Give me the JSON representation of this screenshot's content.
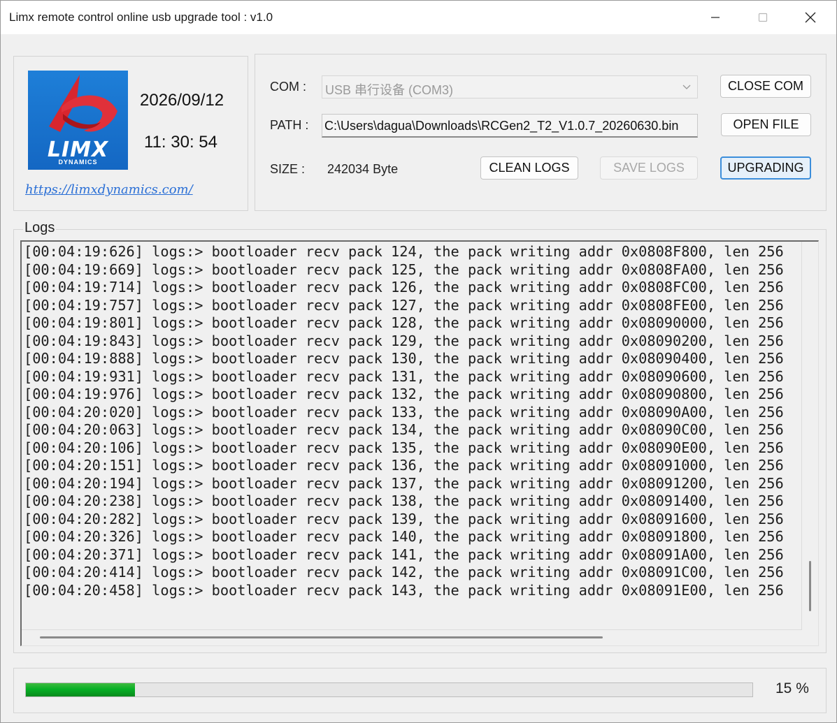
{
  "window": {
    "title": "Limx remote control online usb upgrade tool : v1.0"
  },
  "logo_panel": {
    "logo_word": "LIMX",
    "logo_sub": "DYNAMICS",
    "date": "2026/09/12",
    "time": "11: 30: 54",
    "link": "https://limxdynamics.com/"
  },
  "controls": {
    "com_label": "COM :",
    "com_value": "USB 串行设备 (COM3)",
    "path_label": "PATH :",
    "path_value": "C:\\Users\\dagua\\Downloads\\RCGen2_T2_V1.0.7_20260630.bin",
    "size_label": "SIZE :",
    "size_value": "242034 Byte",
    "close_com_label": "CLOSE COM",
    "open_file_label": "OPEN FILE",
    "clean_logs_label": "CLEAN LOGS",
    "save_logs_label": "SAVE LOGS",
    "upgrading_label": "UPGRADING"
  },
  "logs": {
    "title": "Logs",
    "lines": [
      "[00:04:19:626] logs:> bootloader recv pack 124, the pack writing addr 0x0808F800, len 256",
      "[00:04:19:669] logs:> bootloader recv pack 125, the pack writing addr 0x0808FA00, len 256",
      "[00:04:19:714] logs:> bootloader recv pack 126, the pack writing addr 0x0808FC00, len 256",
      "[00:04:19:757] logs:> bootloader recv pack 127, the pack writing addr 0x0808FE00, len 256",
      "[00:04:19:801] logs:> bootloader recv pack 128, the pack writing addr 0x08090000, len 256",
      "[00:04:19:843] logs:> bootloader recv pack 129, the pack writing addr 0x08090200, len 256",
      "[00:04:19:888] logs:> bootloader recv pack 130, the pack writing addr 0x08090400, len 256",
      "[00:04:19:931] logs:> bootloader recv pack 131, the pack writing addr 0x08090600, len 256",
      "[00:04:19:976] logs:> bootloader recv pack 132, the pack writing addr 0x08090800, len 256",
      "[00:04:20:020] logs:> bootloader recv pack 133, the pack writing addr 0x08090A00, len 256",
      "[00:04:20:063] logs:> bootloader recv pack 134, the pack writing addr 0x08090C00, len 256",
      "[00:04:20:106] logs:> bootloader recv pack 135, the pack writing addr 0x08090E00, len 256",
      "[00:04:20:151] logs:> bootloader recv pack 136, the pack writing addr 0x08091000, len 256",
      "[00:04:20:194] logs:> bootloader recv pack 137, the pack writing addr 0x08091200, len 256",
      "[00:04:20:238] logs:> bootloader recv pack 138, the pack writing addr 0x08091400, len 256",
      "[00:04:20:282] logs:> bootloader recv pack 139, the pack writing addr 0x08091600, len 256",
      "[00:04:20:326] logs:> bootloader recv pack 140, the pack writing addr 0x08091800, len 256",
      "[00:04:20:371] logs:> bootloader recv pack 141, the pack writing addr 0x08091A00, len 256",
      "[00:04:20:414] logs:> bootloader recv pack 142, the pack writing addr 0x08091C00, len 256",
      "[00:04:20:458] logs:> bootloader recv pack 143, the pack writing addr 0x08091E00, len 256"
    ]
  },
  "progress": {
    "percent": 15,
    "label": "15 %"
  },
  "icons": {
    "minimize": "minimize-icon",
    "maximize": "maximize-icon",
    "close": "close-icon",
    "combo_arrow": "chevron-down-icon"
  },
  "colors": {
    "logo_blue": "#1467c3",
    "logo_red": "#d8262e",
    "progress_green": "#06b025",
    "link_blue": "#2a6fd6",
    "active_button_border": "#3c8edb"
  }
}
